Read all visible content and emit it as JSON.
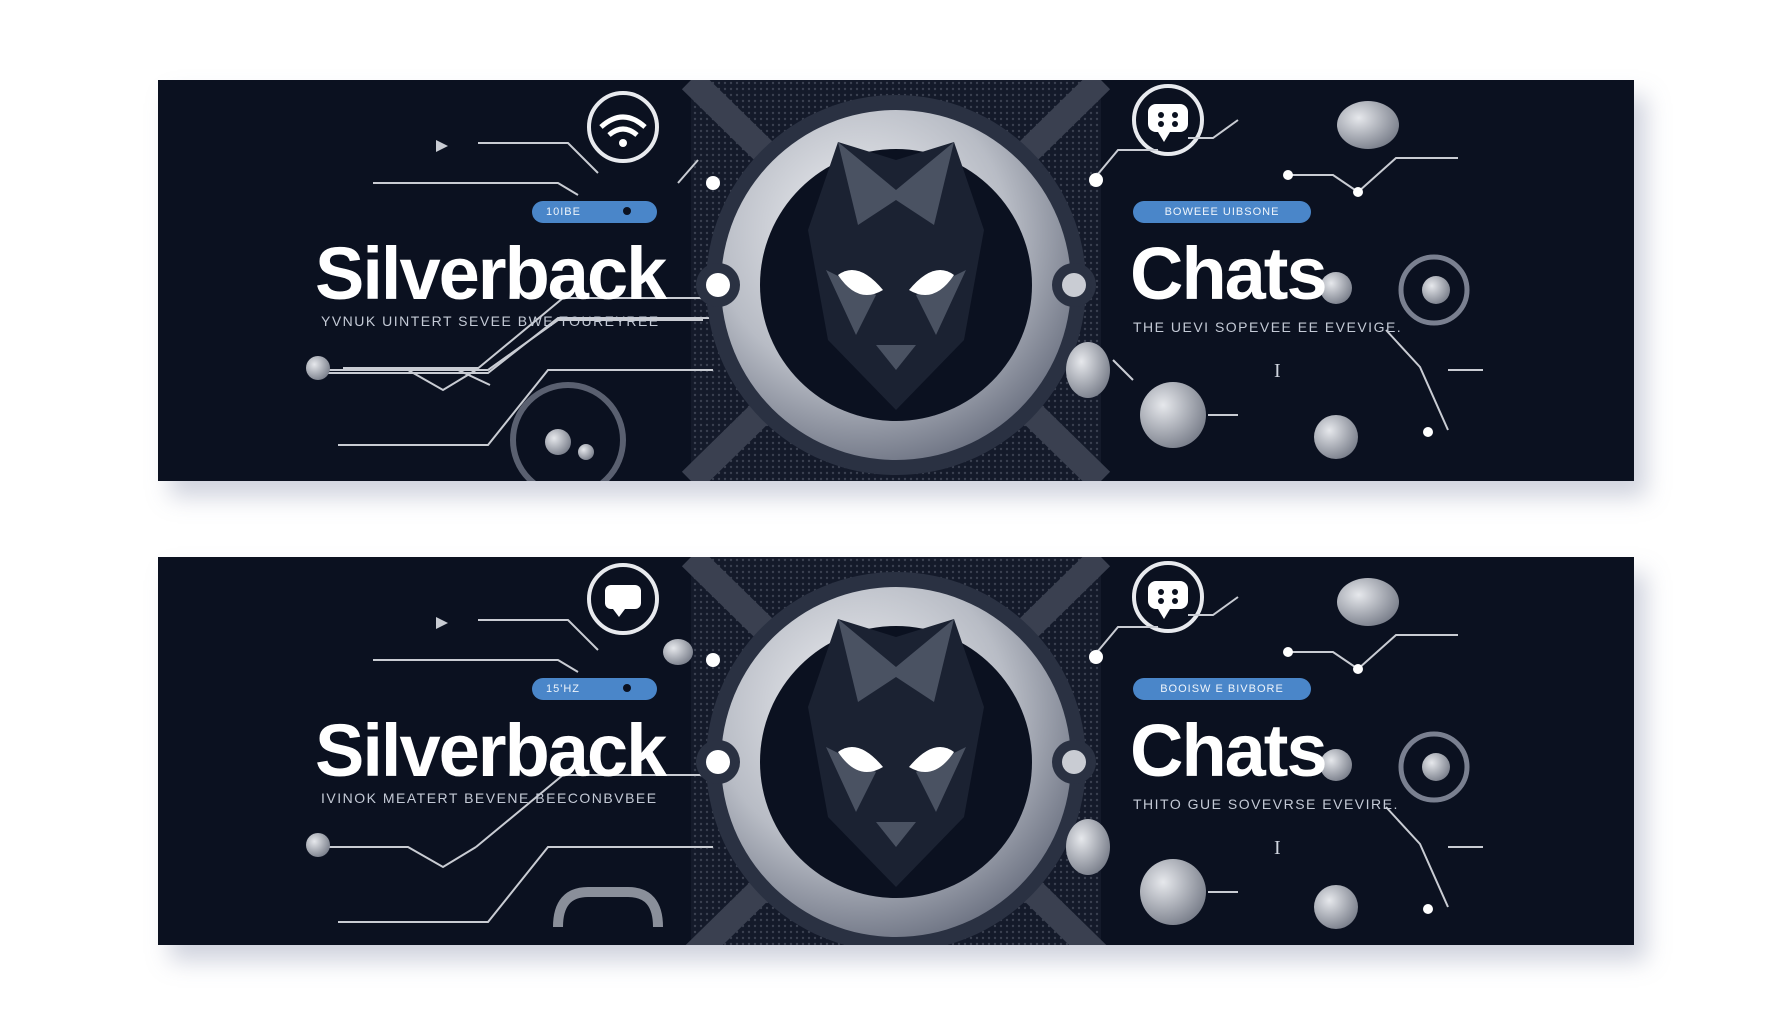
{
  "banners": [
    {
      "title_left": "Silverback",
      "title_right": "Chats",
      "subtitle_left": "YVNUK UINTERT SEVEE BWE TOUREYREE",
      "subtitle_right": "THE UEVI SOPEVEE EE EVEVIGE.",
      "pill_left": "10IBE",
      "pill_right": "BOWEEE UIBSONE",
      "top_left_icon": "wifi-icon",
      "top_right_icon": "chat-bubble-icon"
    },
    {
      "title_left": "Silverback",
      "title_right": "Chats",
      "subtitle_left": "IVINOK MEATERT BEVENE BEECONBVBEE",
      "subtitle_right": "THITO GUE SOVEVRSE EVEVIRE.",
      "pill_left": "15'HZ",
      "pill_right": "BOOISW E BIVBORE",
      "top_left_icon": "message-icon",
      "top_right_icon": "chat-bubble-icon"
    }
  ],
  "cursor_glyph": "I",
  "colors": {
    "background": "#0b1120",
    "accent": "#4a86c9",
    "silver": "#c9ccd3"
  }
}
